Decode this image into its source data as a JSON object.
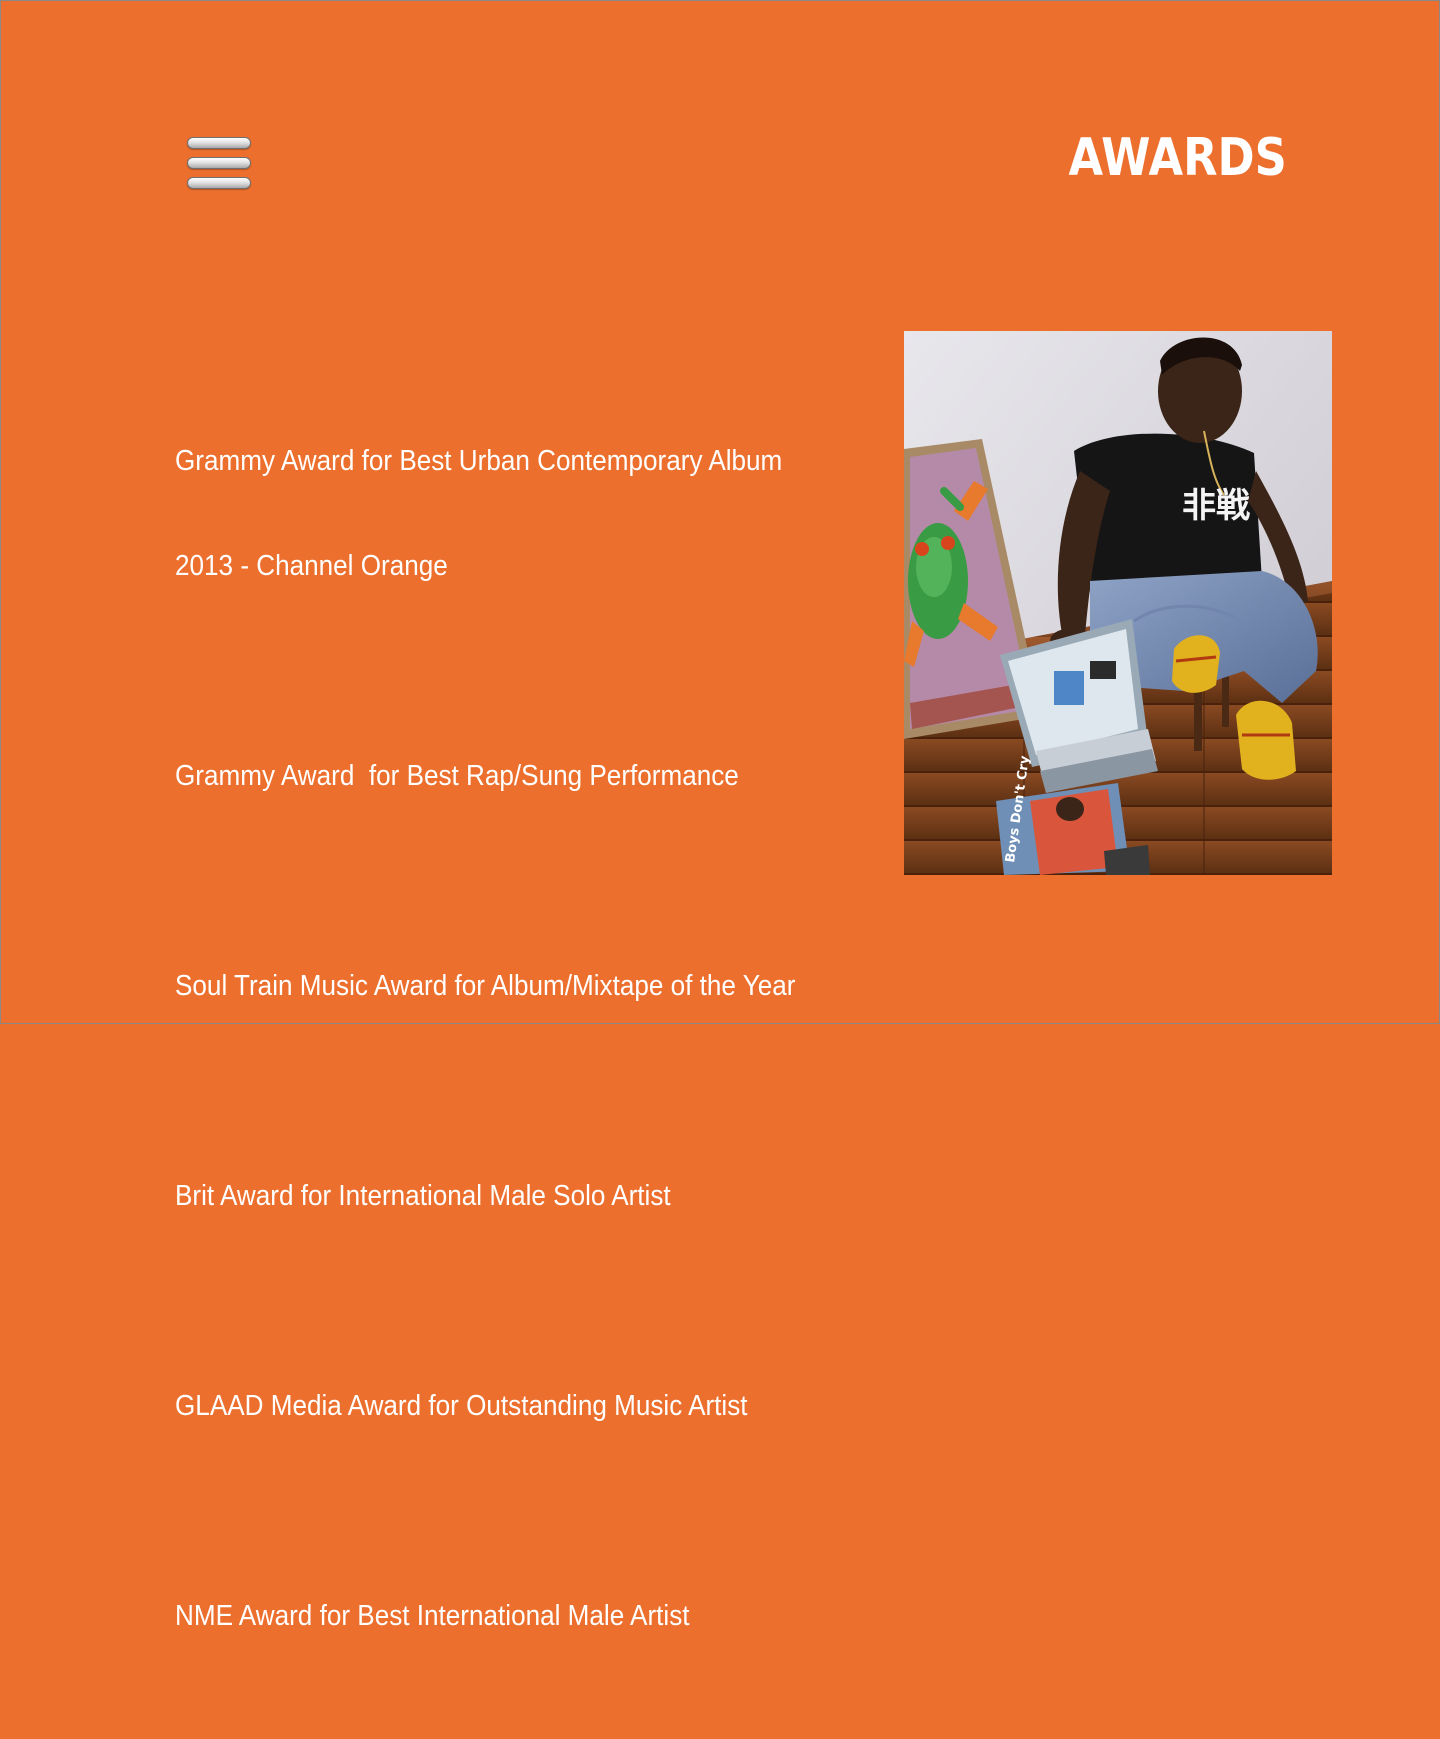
{
  "header": {
    "title": "AWARDS",
    "menu_icon": "hamburger-menu-icon"
  },
  "awards": [
    {
      "line1": "Grammy Award for Best Urban Contemporary Album",
      "line2": "2013 - Channel Orange"
    },
    {
      "line1": "Grammy Award  for Best Rap/Sung Performance"
    },
    {
      "line1": "Soul Train Music Award for Album/Mixtape of the Year"
    },
    {
      "line1": "Brit Award for International Male Solo Artist"
    },
    {
      "line1": "GLAAD Media Award for Outstanding Music Artist"
    },
    {
      "line1": "NME Award for Best International Male Artist"
    }
  ],
  "photo": {
    "shirt_text": "非戦",
    "magazine_text": "Boys Don't Cry"
  },
  "colors": {
    "background": "#ec6f2d",
    "text": "#ffffff"
  }
}
